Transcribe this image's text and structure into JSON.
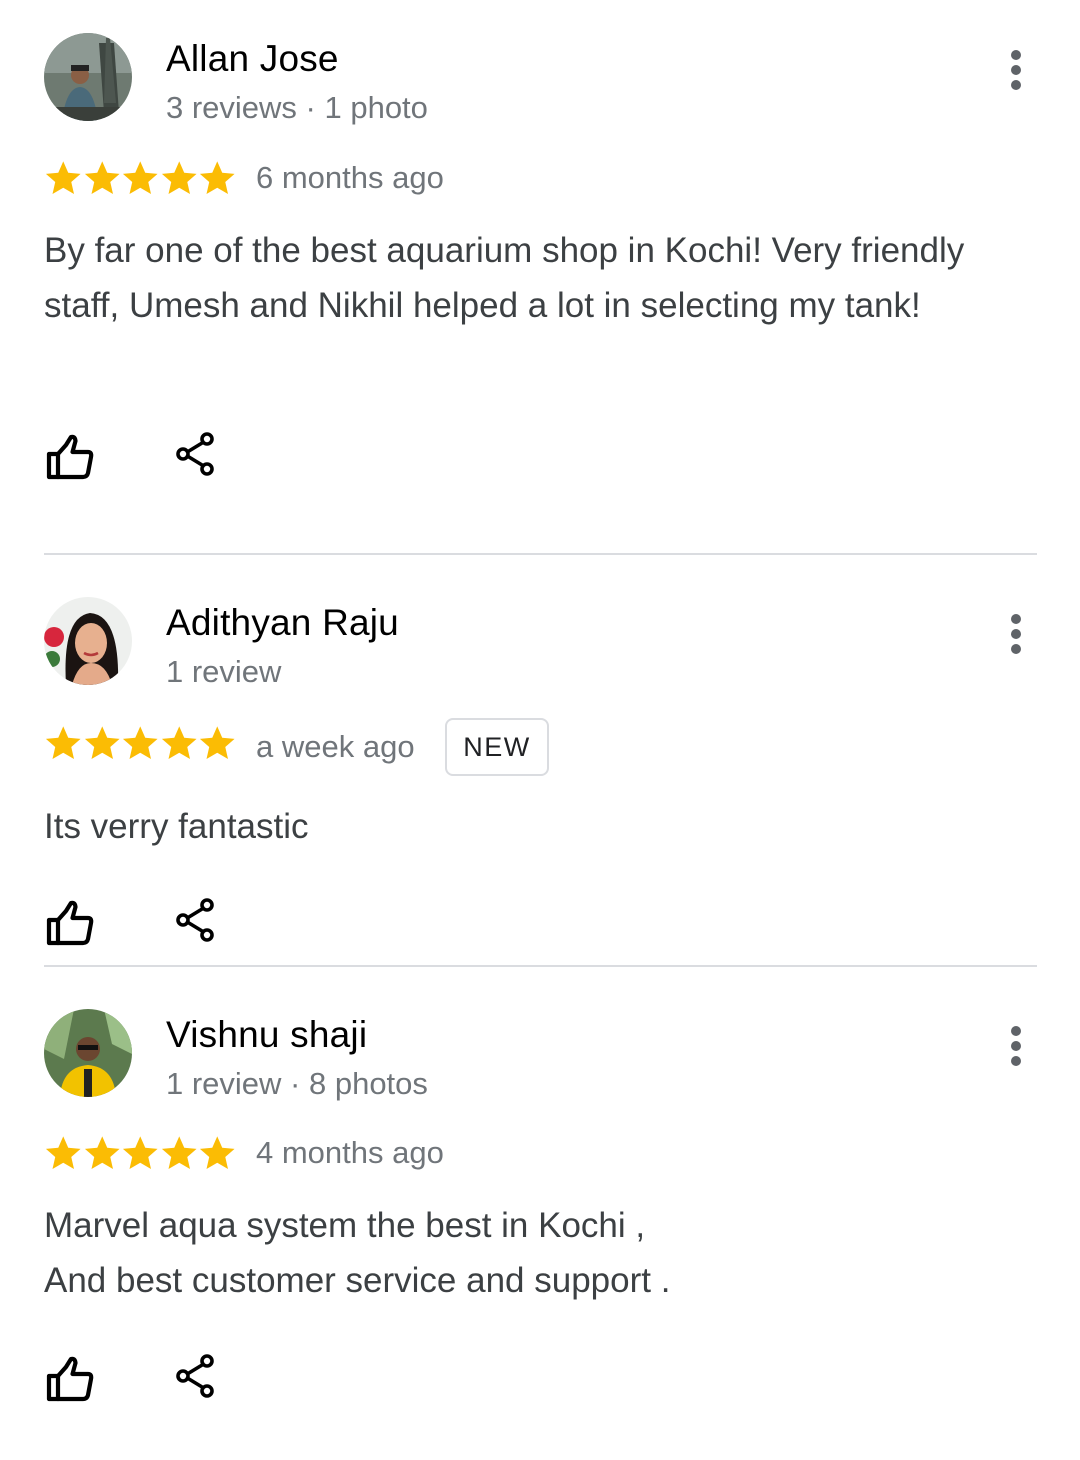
{
  "colors": {
    "star": "#fbbc04",
    "secondary_text": "#70757a",
    "divider": "#dadce0"
  },
  "reviews": [
    {
      "name": "Allan Jose",
      "meta": "3 reviews · 1 photo",
      "rating": 5,
      "date": "6 months ago",
      "text": "By far one of the best aquarium shop in Kochi! Very friendly staff, Umesh and Nikhil helped a lot in selecting my tank!",
      "icons": [
        "thumbs-up-icon",
        "share-icon",
        "more-vert-icon"
      ]
    },
    {
      "name": "Adithyan Raju",
      "meta": "1 review",
      "rating": 5,
      "date": "a week ago",
      "badge": "NEW",
      "text": "Its verry fantastic",
      "icons": [
        "thumbs-up-icon",
        "share-icon",
        "more-vert-icon"
      ]
    },
    {
      "name": "Vishnu shaji",
      "meta": "1 review · 8 photos",
      "rating": 5,
      "date": "4 months ago",
      "text": "Marvel aqua system  the best in Kochi ,\nAnd best customer service and support .",
      "icons": [
        "thumbs-up-icon",
        "share-icon",
        "more-vert-icon"
      ]
    }
  ]
}
